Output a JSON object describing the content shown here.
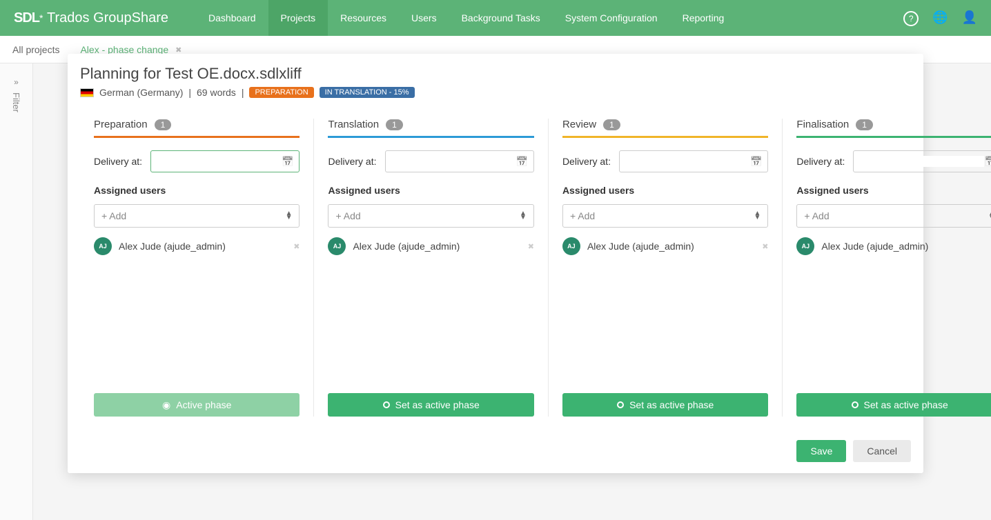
{
  "brand": {
    "sdl": "SDL",
    "star": "*",
    "rest": "Trados GroupShare"
  },
  "nav": {
    "items": [
      "Dashboard",
      "Projects",
      "Resources",
      "Users",
      "Background Tasks",
      "System Configuration",
      "Reporting"
    ],
    "activeIndex": 1
  },
  "crumbs": {
    "all": "All projects",
    "current": "Alex - phase change"
  },
  "filterRail": {
    "label": "Filter"
  },
  "modal": {
    "title": "Planning for Test OE.docx.sdlxliff",
    "language": "German (Germany)",
    "words": "69 words",
    "badge_prep": "PREPARATION",
    "badge_trans": "IN TRANSLATION - 15%",
    "deliveryLabel": "Delivery at:",
    "assignedLabel": "Assigned users",
    "addPlaceholder": "+ Add",
    "activePhaseLabel": "Active phase",
    "setActiveLabel": "Set as active phase",
    "save": "Save",
    "cancel": "Cancel",
    "user": {
      "initials": "AJ",
      "display": "Alex Jude (ajude_admin)"
    },
    "phases": [
      {
        "name": "Preparation",
        "count": "1",
        "barClass": "bar-orange",
        "active": true
      },
      {
        "name": "Translation",
        "count": "1",
        "barClass": "bar-blue",
        "active": false
      },
      {
        "name": "Review",
        "count": "1",
        "barClass": "bar-yellow",
        "active": false
      },
      {
        "name": "Finalisation",
        "count": "1",
        "barClass": "bar-green",
        "active": false
      }
    ]
  }
}
